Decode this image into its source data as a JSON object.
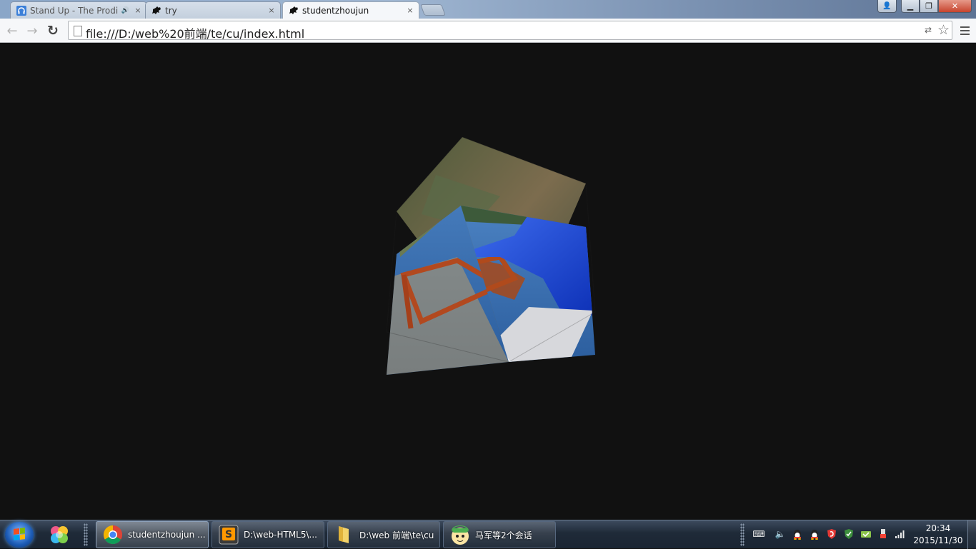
{
  "browser": {
    "tabs": [
      {
        "title": "Stand Up - The Prodi",
        "icon": "headphones-icon",
        "playing_audio": true,
        "active": false
      },
      {
        "title": "try",
        "icon": "puzzle-icon",
        "playing_audio": false,
        "active": false
      },
      {
        "title": "studentzhoujun",
        "icon": "puzzle-icon",
        "playing_audio": false,
        "active": true
      }
    ],
    "url": "file:///D:/web%20前端/te/cu/index.html",
    "close_glyph": "×",
    "nav": {
      "back": "←",
      "forward": "→",
      "reload": "↻"
    },
    "omnibox_icons": {
      "translate": "⇄",
      "bookmark": "☆"
    }
  },
  "window_controls": {
    "user": "👤",
    "minimize": "▁",
    "maximize": "❐",
    "close": "✕"
  },
  "content": {
    "background": "#111111",
    "cube_faces": [
      "top-face-photo",
      "left-face-photo",
      "front-face-photo"
    ]
  },
  "taskbar": {
    "items": [
      {
        "label": "studentzhoujun ...",
        "icon": "chrome-icon",
        "active": true
      },
      {
        "label": "D:\\web-HTML5\\...",
        "icon": "sublime-text-icon",
        "active": false
      },
      {
        "label": "D:\\web 前端\\te\\cu",
        "icon": "folder-icon",
        "active": false
      },
      {
        "label": "马军等2个会话",
        "icon": "qq-chat-icon",
        "active": false
      }
    ],
    "tray_icons": [
      "keyboard-icon",
      "volume-icon",
      "qq-penguin-icon",
      "qq-penguin-icon",
      "red-shield-icon",
      "security-icon",
      "network-icon",
      "usb-icon",
      "signal-icon"
    ],
    "clock": {
      "time": "20:34",
      "date": "2015/11/30"
    }
  }
}
